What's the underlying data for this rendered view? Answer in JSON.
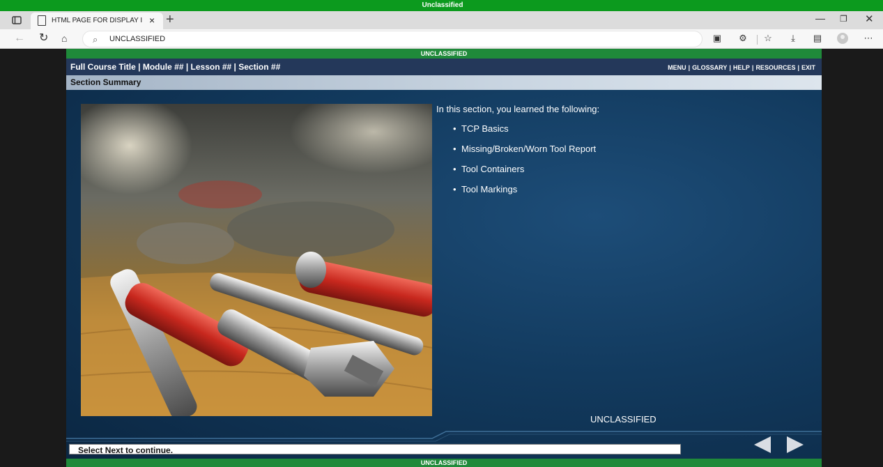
{
  "classification": {
    "banner": "Unclassified"
  },
  "browser": {
    "tab_title": "HTML PAGE FOR DISPLAY IN BRO",
    "url": "UNCLASSIFIED"
  },
  "course": {
    "classification_top": "UNCLASSIFIED",
    "classification_bottom": "UNCLASSIFIED",
    "title": "Full Course Title | Module ## | Lesson ## | Section ##",
    "menu": [
      "MENU",
      "GLOSSARY",
      "HELP",
      "RESOURCES",
      "EXIT"
    ],
    "section_title": "Section Summary",
    "intro": "In this section, you learned the following:",
    "items": [
      "TCP Basics",
      "Missing/Broken/Worn Tool Report",
      "Tool Containers",
      "Tool Markings"
    ],
    "content_classification": "UNCLASSIFIED",
    "status": "Select Next to continue."
  },
  "colors": {
    "classification_green": "#0c9a1e",
    "header": "#24385a",
    "content_bg": "#123a5e"
  },
  "icons": {
    "tab_toggle": "tab-actions-icon",
    "page": "page-icon",
    "close": "close-icon",
    "new_tab": "plus-icon",
    "back": "back-arrow-icon",
    "refresh": "refresh-icon",
    "home": "home-icon",
    "search": "search-icon",
    "extensions": [
      "outlook-icon",
      "extensions-icon",
      "favorites-icon",
      "downloads-icon",
      "collections-icon"
    ],
    "more": "more-icon"
  }
}
